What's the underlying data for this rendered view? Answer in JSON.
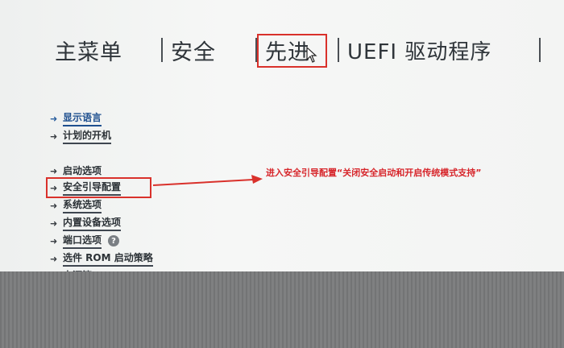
{
  "tabs": [
    "主菜单",
    "安全",
    "先进",
    "UEFI 驱动程序"
  ],
  "menu": [
    {
      "label": "显示语言",
      "style": "blue"
    },
    {
      "label": "计划的开机",
      "style": "dark"
    },
    {
      "label": "启动选项",
      "style": "plain"
    },
    {
      "label": "安全引导配置",
      "style": "dark"
    },
    {
      "label": "系统选项",
      "style": "dark"
    },
    {
      "label": "内置设备选项",
      "style": "dark"
    },
    {
      "label": "端口选项",
      "style": "dark"
    },
    {
      "label": "选件 ROM 启动策略",
      "style": "dark"
    },
    {
      "label": "电源管",
      "style": "plain"
    }
  ],
  "help_glyph": "?",
  "annotation": "进入安全引导配置“关闭安全启动和开启传统模式支持”",
  "colors": {
    "highlight": "#d9312b",
    "link": "#1e4f8f"
  }
}
